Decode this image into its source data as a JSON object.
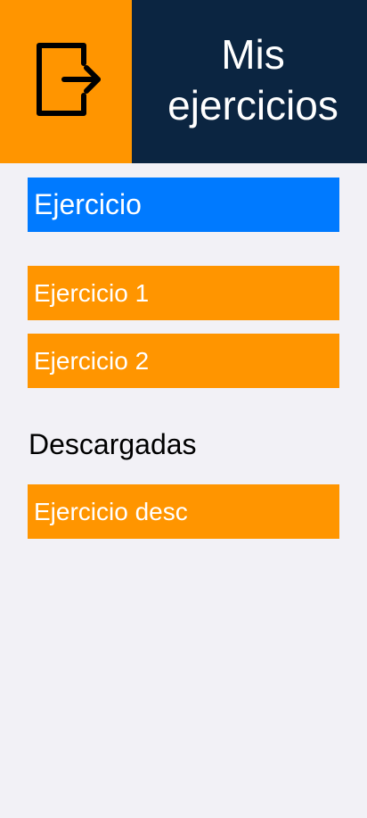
{
  "header": {
    "logout_icon": "logout-icon",
    "title": "Mis ejercicios"
  },
  "colors": {
    "accent_orange": "#ff9500",
    "header_dark": "#0b2541",
    "primary_blue": "#007aff",
    "background": "#f2f1f6"
  },
  "main": {
    "primary_button": "Ejercicio",
    "exercises": [
      "Ejercicio 1",
      "Ejercicio 2"
    ],
    "downloads_title": "Descargadas",
    "downloads": [
      "Ejercicio desc"
    ]
  }
}
